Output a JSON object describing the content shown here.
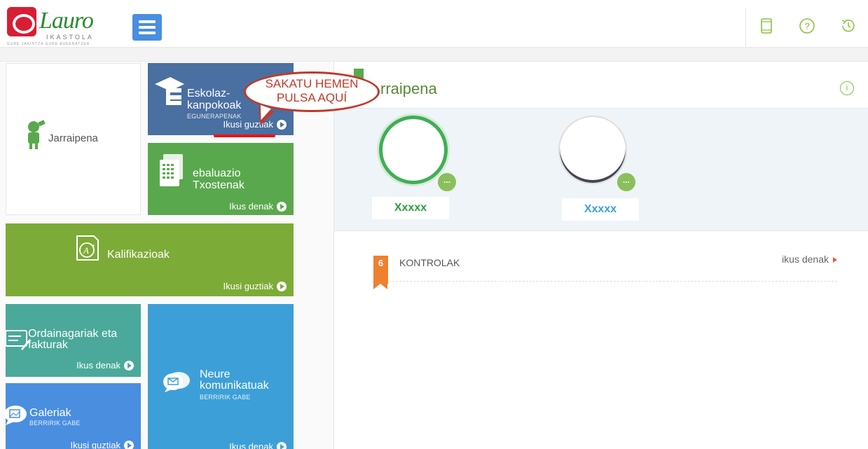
{
  "header": {
    "logo_text": "Lauro",
    "logo_sub": "IKASTOLA",
    "logo_tagline": "GURE JAKINTZA GURE AUKERATZEA",
    "icons": [
      "tablet-icon",
      "help-icon",
      "history-icon"
    ],
    "accent": "#4a8ee0"
  },
  "tiles": {
    "jarraipena": {
      "label": "Jarraipena"
    },
    "eskolaz": {
      "label": "Eskolaz-kanpokoak",
      "label1": "Eskolaz-",
      "label2": "kanpokoak",
      "small": "EGUNERAPENAK",
      "link": "Ikusi guztiak"
    },
    "ebaluazio": {
      "label1": "ebaluazio",
      "label2": "Txostenak",
      "link": "Ikus denak"
    },
    "kalifikazioak": {
      "label": "Kalifikazioak",
      "link": "Ikusi guztiak"
    },
    "ordainagariak": {
      "label1": "Ordainagariak eta",
      "label2": "fakturak",
      "link": "Ikus denak"
    },
    "neure": {
      "label1": "Neure",
      "label2": "komunikatuak",
      "small": "BERRIRIK GABE",
      "link": "Ikus denak"
    },
    "galeriak": {
      "label": "Galeriak",
      "small": "BERRIRIK GABE",
      "link": "Ikusi guztiak"
    }
  },
  "callout": {
    "line1": "SAKATU HEMEN",
    "line2": "PULSA AQUÍ"
  },
  "right": {
    "title": "Jarraipena",
    "title_visible": "rraipena",
    "students": [
      {
        "name": "Xxxxx",
        "color": "#2e9e3e"
      },
      {
        "name": "Xxxxx",
        "color": "#3d9fd8"
      }
    ],
    "kontrolak": {
      "count": "6",
      "title": "KONTROLAK",
      "more": "ikus denak"
    }
  }
}
